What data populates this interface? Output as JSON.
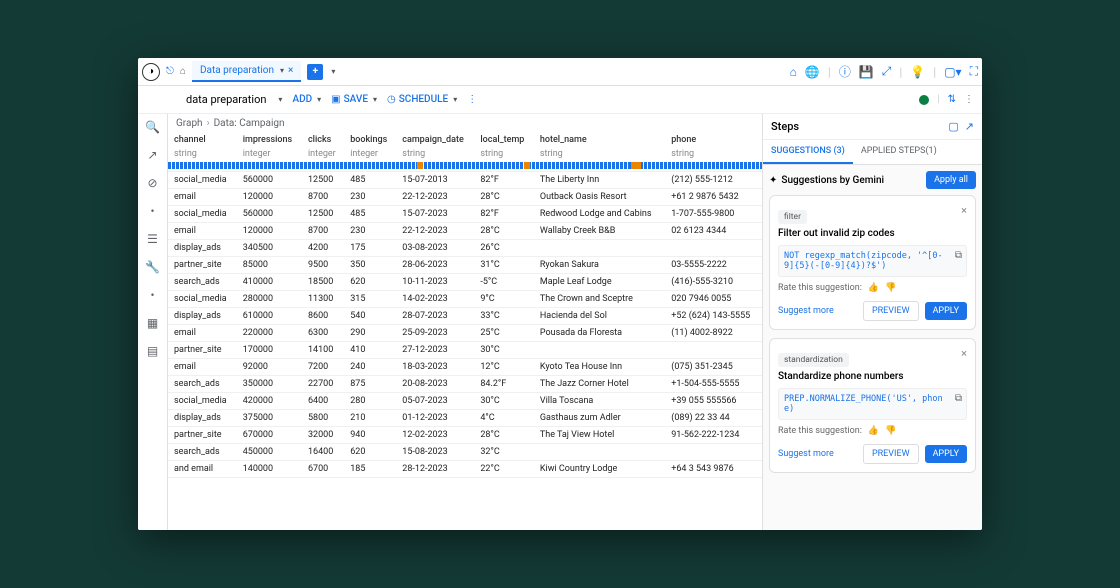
{
  "topbar": {
    "nav_icon": "⎋",
    "home_icon": "⌂",
    "tab_label": "Data preparation",
    "tab_close": "×",
    "new_tab": "+"
  },
  "toolbar": {
    "title": "data preparation",
    "add": "ADD",
    "save": "SAVE",
    "schedule": "SCHEDULE"
  },
  "crumbs": {
    "a": "Graph",
    "b": "Data: Campaign"
  },
  "columns": [
    {
      "name": "channel",
      "type": "string"
    },
    {
      "name": "impressions",
      "type": "integer"
    },
    {
      "name": "clicks",
      "type": "integer"
    },
    {
      "name": "bookings",
      "type": "integer"
    },
    {
      "name": "campaign_date",
      "type": "string"
    },
    {
      "name": "local_temp",
      "type": "string"
    },
    {
      "name": "hotel_name",
      "type": "string"
    },
    {
      "name": "phone",
      "type": "string"
    }
  ],
  "rows": [
    [
      "social_media",
      "560000",
      "12500",
      "485",
      "15-07-2013",
      "82°F",
      "The Liberty Inn",
      "(212) 555-1212"
    ],
    [
      "email",
      "120000",
      "8700",
      "230",
      "22-12-2023",
      "28°C",
      "Outback Oasis Resort",
      "+61 2 9876 5432"
    ],
    [
      "social_media",
      "560000",
      "12500",
      "485",
      "15-07-2023",
      "82°F",
      "Redwood Lodge and Cabins",
      "1-707-555-9800"
    ],
    [
      "email",
      "120000",
      "8700",
      "230",
      "22-12-2023",
      "28°C",
      "Wallaby Creek B&B",
      "02 6123 4344"
    ],
    [
      "display_ads",
      "340500",
      "4200",
      "175",
      "03-08-2023",
      "26°C",
      "",
      ""
    ],
    [
      "partner_site",
      "85000",
      "9500",
      "350",
      "28-06-2023",
      "31°C",
      "Ryokan Sakura",
      "03-5555-2222"
    ],
    [
      "search_ads",
      "410000",
      "18500",
      "620",
      "10-11-2023",
      "-5°C",
      "Maple Leaf Lodge",
      "(416)-555-3210"
    ],
    [
      "social_media",
      "280000",
      "11300",
      "315",
      "14-02-2023",
      "9°C",
      "The Crown and Sceptre",
      "020 7946 0055"
    ],
    [
      "display_ads",
      "610000",
      "8600",
      "540",
      "28-07-2023",
      "33°C",
      "Hacienda del Sol",
      "+52 (624) 143-5555"
    ],
    [
      "email",
      "220000",
      "6300",
      "290",
      "25-09-2023",
      "25°C",
      "Pousada da Floresta",
      "(11) 4002-8922"
    ],
    [
      "partner_site",
      "170000",
      "14100",
      "410",
      "27-12-2023",
      "30°C",
      "",
      ""
    ],
    [
      "email",
      "92000",
      "7200",
      "240",
      "18-03-2023",
      "12°C",
      "Kyoto Tea House Inn",
      "(075) 351-2345"
    ],
    [
      "search_ads",
      "350000",
      "22700",
      "875",
      "20-08-2023",
      "84.2°F",
      "The Jazz Corner Hotel",
      "+1-504-555-5555"
    ],
    [
      "social_media",
      "420000",
      "6400",
      "280",
      "05-07-2023",
      "30°C",
      "Villa Toscana",
      "+39 055 555566"
    ],
    [
      "display_ads",
      "375000",
      "5800",
      "210",
      "01-12-2023",
      "4°C",
      "Gasthaus zum Adler",
      "(089) 22 33 44"
    ],
    [
      "partner_site",
      "670000",
      "32000",
      "940",
      "12-02-2023",
      "28°C",
      "The Taj View Hotel",
      "91-562-222-1234"
    ],
    [
      "search_ads",
      "450000",
      "16400",
      "620",
      "15-08-2023",
      "32°C",
      "",
      ""
    ],
    [
      "email",
      "140000",
      "6700",
      "185",
      "28-12-2023",
      "22°C",
      "Kiwi Country Lodge",
      "+64 3 543 9876"
    ]
  ],
  "last_row_prefix": "and",
  "steps": {
    "title": "Steps",
    "tab_suggestions": "SUGGESTIONS (3)",
    "tab_applied": "APPLIED STEPS(1)",
    "gemini_title": "Suggestions by Gemini",
    "apply_all": "Apply all",
    "cards": [
      {
        "tag": "filter",
        "title": "Filter out invalid zip codes",
        "code": "NOT regexp_match(zipcode, '^[0-9]{5}(-[0-9]{4})?$')",
        "rate": "Rate this suggestion:",
        "suggest": "Suggest more",
        "preview": "PREVIEW",
        "apply": "APPLY"
      },
      {
        "tag": "standardization",
        "title": "Standardize phone numbers",
        "code": "PREP.NORMALIZE_PHONE('US', phone)",
        "rate": "Rate this suggestion:",
        "suggest": "Suggest more",
        "preview": "PREVIEW",
        "apply": "APPLY"
      }
    ]
  }
}
